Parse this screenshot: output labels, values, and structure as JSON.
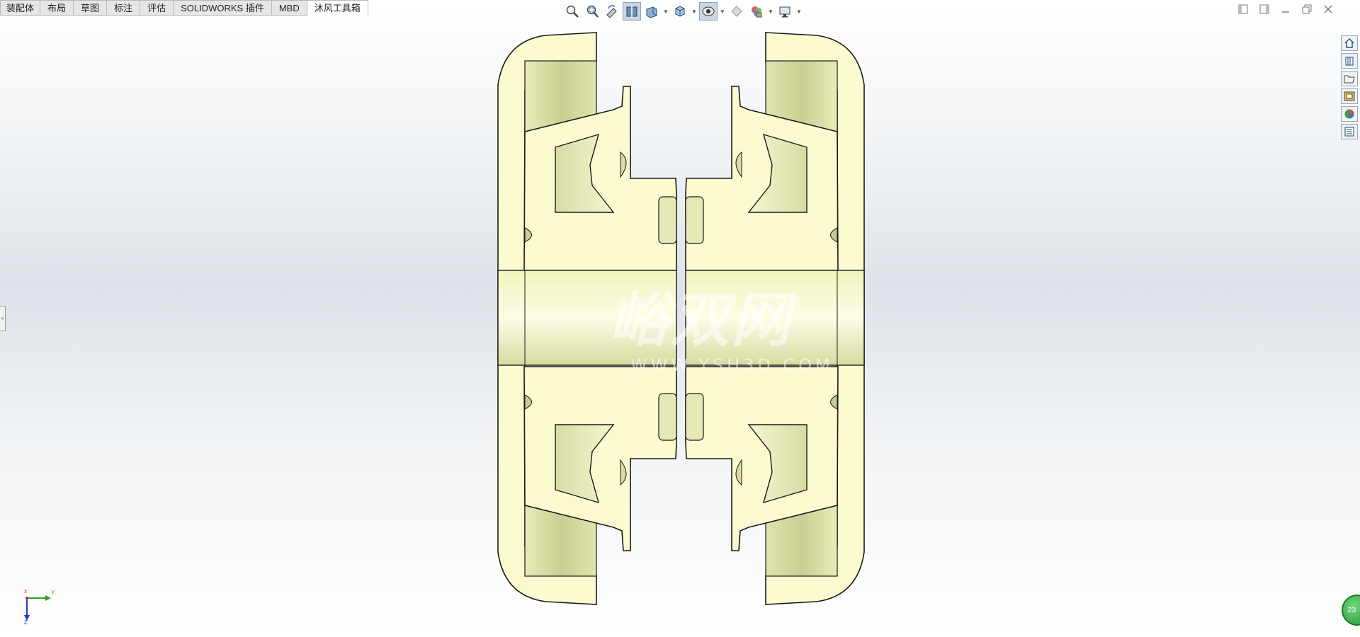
{
  "tabs": [
    {
      "label": "装配体",
      "active": false
    },
    {
      "label": "布局",
      "active": false
    },
    {
      "label": "草图",
      "active": false
    },
    {
      "label": "标注",
      "active": false
    },
    {
      "label": "评估",
      "active": false
    },
    {
      "label": "SOLIDWORKS 插件",
      "active": false
    },
    {
      "label": "MBD",
      "active": false
    },
    {
      "label": "沐风工具箱",
      "active": true
    }
  ],
  "heads_up_toolbar": [
    "zoom-to-fit-icon",
    "zoom-to-area-icon",
    "previous-view-icon",
    "section-view-icon",
    "dynamic-annotation-icon",
    "view-orientation-icon",
    "display-style-icon",
    "hide-show-items-icon",
    "edit-appearance-icon",
    "apply-scene-icon",
    "view-settings-icon"
  ],
  "task_pane": [
    "home-icon",
    "design-library-icon",
    "file-explorer-icon",
    "view-palette-icon",
    "appearances-icon",
    "custom-properties-icon"
  ],
  "triad": {
    "axis_y": "Y",
    "axis_x": "X",
    "axis_z": "Z"
  },
  "watermark": {
    "logo_text": "峪双网",
    "url": "WWW.YSH3D.COM"
  },
  "badge": {
    "text": "23"
  },
  "colors": {
    "part_fill": "#fbfbcf",
    "part_shade": "#cdd29a",
    "outline": "#1a1a1a",
    "background": "#e2e6eb"
  }
}
